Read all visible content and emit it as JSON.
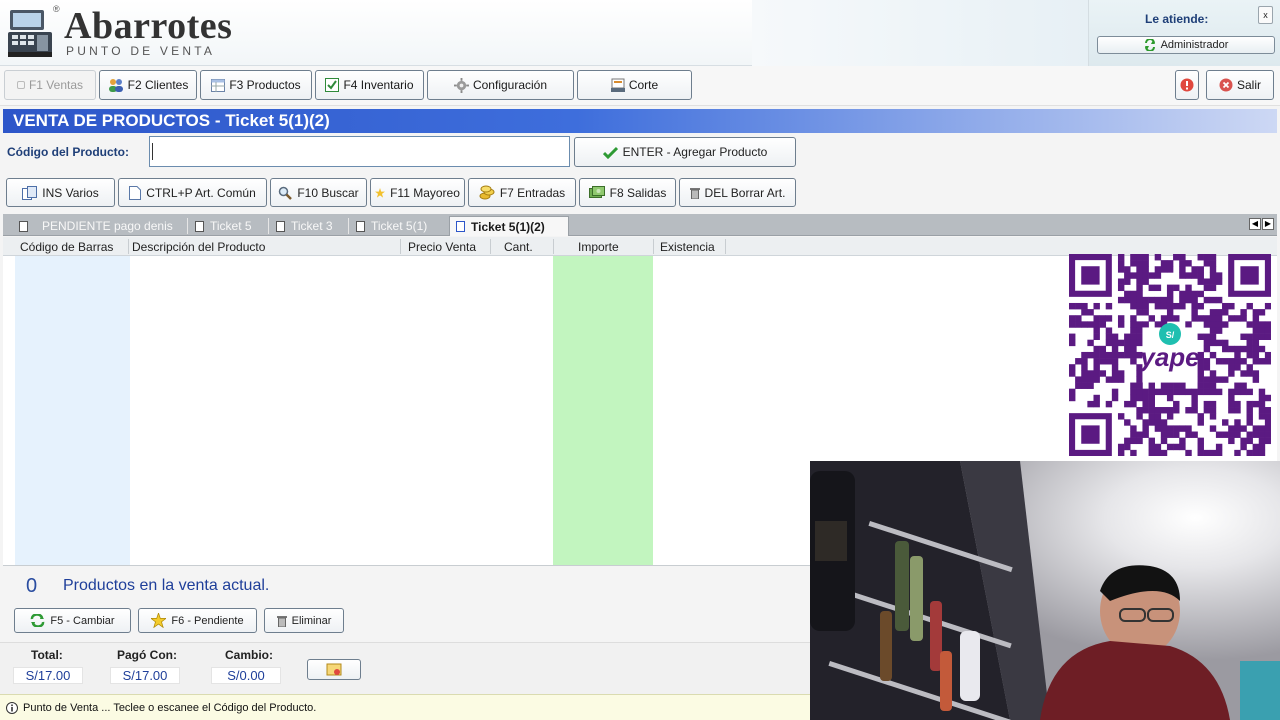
{
  "header": {
    "app_title": "Abarrotes",
    "app_subtitle": "PUNTO DE VENTA",
    "registered_mark": "®",
    "attendant_label": "Le atiende:",
    "attendant_name": "Administrador",
    "close_glyph": "x"
  },
  "nav": {
    "items": [
      {
        "label": "F1 Ventas",
        "icon": "cart-icon",
        "disabled": true
      },
      {
        "label": "F2 Clientes",
        "icon": "people-icon"
      },
      {
        "label": "F3 Productos",
        "icon": "table-icon"
      },
      {
        "label": "F4 Inventario",
        "icon": "inventory-icon"
      },
      {
        "label": "Configuración",
        "icon": "gear-icon"
      },
      {
        "label": "Corte",
        "icon": "register-icon"
      }
    ],
    "exit_label": "Salir"
  },
  "sale": {
    "title": "VENTA DE PRODUCTOS - Ticket 5(1)(2)",
    "code_label": "Código del Producto:",
    "code_value": "",
    "add_button": "ENTER - Agregar Producto"
  },
  "actions": [
    {
      "label": "INS Varios",
      "icon": "boxes-icon"
    },
    {
      "label": "CTRL+P Art. Común",
      "icon": "page-icon"
    },
    {
      "label": "F10 Buscar",
      "icon": "search-icon"
    },
    {
      "label": "F11 Mayoreo",
      "icon": "star-icon"
    },
    {
      "label": "F7 Entradas",
      "icon": "coins-in-icon"
    },
    {
      "label": "F8 Salidas",
      "icon": "money-out-icon"
    },
    {
      "label": "DEL Borrar Art.",
      "icon": "trash-icon"
    }
  ],
  "tabs": [
    {
      "label": "PENDIENTE pago denis"
    },
    {
      "label": "Ticket 5"
    },
    {
      "label": "Ticket 3"
    },
    {
      "label": "Ticket 5(1)"
    },
    {
      "label": "Ticket 5(1)(2)",
      "active": true
    }
  ],
  "table": {
    "columns": [
      "Código de Barras",
      "Descripción del Producto",
      "Precio Venta",
      "Cant.",
      "Importe",
      "Existencia"
    ],
    "rows": []
  },
  "summary": {
    "count": "0",
    "count_text": "Productos en la venta actual.",
    "buttons": [
      "F5 - Cambiar",
      "F6 - Pendiente",
      "Eliminar"
    ],
    "total_label": "Total:",
    "total_value": "S/17.00",
    "paid_label": "Pagó Con:",
    "paid_value": "S/17.00",
    "change_label": "Cambio:",
    "change_value": "S/0.00"
  },
  "qr": {
    "brand": "yape",
    "currency": "S/"
  },
  "status_text": "Punto de Venta ... Teclee o escanee el Código del Producto.",
  "colors": {
    "title_bar": "#3e6edc",
    "label_blue": "#1f3f78",
    "importe_column": "#c2f5bf",
    "barcode_column": "#e6f2fd",
    "qr_purple": "#5b1a82"
  }
}
